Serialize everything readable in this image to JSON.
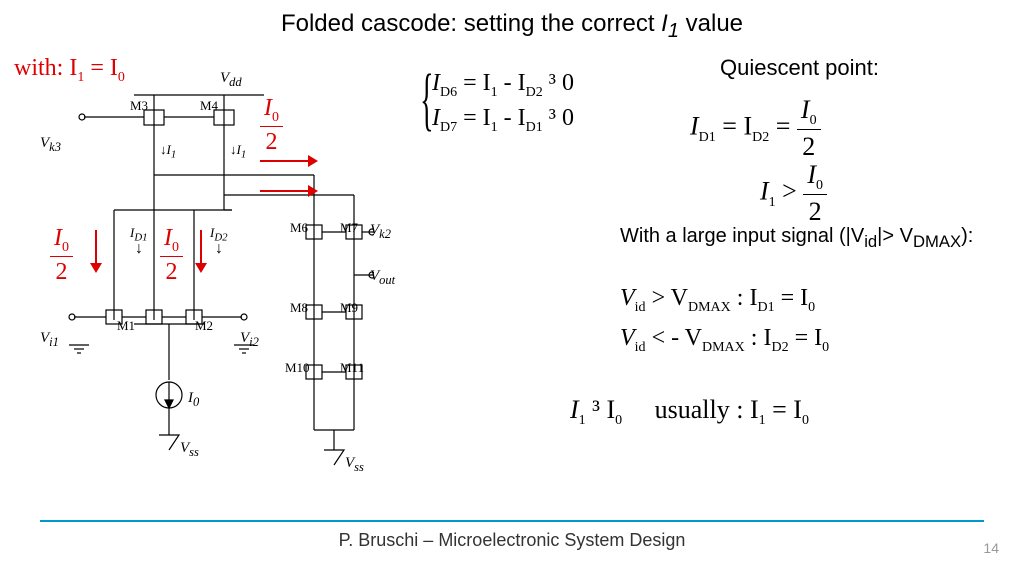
{
  "title_pre": "Folded cascode: setting the correct ",
  "title_var": "I",
  "title_sub": "1",
  "title_post": " value",
  "with_label": "with:  I",
  "with_eq": " = I",
  "eq1_lhs": "I",
  "eq1_sub": "D6",
  "eq1_mid": " = I",
  "eq1_s2": "1",
  "eq1_m2": " - I",
  "eq1_s3": "D2",
  "eq1_tail": " ³  0",
  "eq2_lhs": "I",
  "eq2_sub": "D7",
  "eq2_mid": " = I",
  "eq2_s2": "1",
  "eq2_m2": " - I",
  "eq2_s3": "D1",
  "eq2_tail": " ³  0",
  "qp_title": "Quiescent point:",
  "qp1_a": "I",
  "qp1_as": "D1",
  "qp1_b": " = I",
  "qp1_bs": "D2",
  "qp1_c": " = ",
  "qp2_a": "I",
  "qp2_as": "1",
  "qp2_b": " > ",
  "frac_n": "I",
  "frac_ns": "0",
  "frac_d": "2",
  "large_title": "With a large input signal (|V",
  "large_sub": "id",
  "large_title2": "|> V",
  "large_sub2": "DMAX",
  "large_title3": "):",
  "c1a": "V",
  "c1as": "id",
  "c1b": " > V",
  "c1bs": "DMAX",
  "c1c": " : I",
  "c1cs": "D1",
  "c1d": " = I",
  "c1ds": "0",
  "c2a": "V",
  "c2as": "id",
  "c2b": " < - V",
  "c2bs": "DMAX",
  "c2c": " : I",
  "c2cs": "D2",
  "c2d": " = I",
  "c2ds": "0",
  "la": "I",
  "las": "1",
  "lb": " ³  I",
  "lbs": "0",
  "lc": "usually : I",
  "lcs": "1",
  "ld": " = I",
  "lds": "0",
  "labels": {
    "vdd": "V",
    "vdd_s": "dd",
    "m3": "M3",
    "m4": "M4",
    "vk3": "V",
    "vk3_s": "k3",
    "i1": "I",
    "i1_s": "1",
    "id1": "I",
    "id1_s": "D1",
    "id2": "I",
    "id2_s": "D2",
    "m1": "M1",
    "m2": "M2",
    "vi1": "V",
    "vi1_s": "i1",
    "vi2": "V",
    "vi2_s": "i2",
    "i0": "I",
    "i0_s": "0",
    "vss": "V",
    "vss_s": "ss",
    "m6": "M6",
    "m7": "M7",
    "vk2": "V",
    "vk2_s": "k2",
    "vout": "V",
    "vout_s": "out",
    "m8": "M8",
    "m9": "M9",
    "m10": "M10",
    "m11": "M11"
  },
  "footer": "P. Bruschi – Microelectronic System Design",
  "page": "14"
}
